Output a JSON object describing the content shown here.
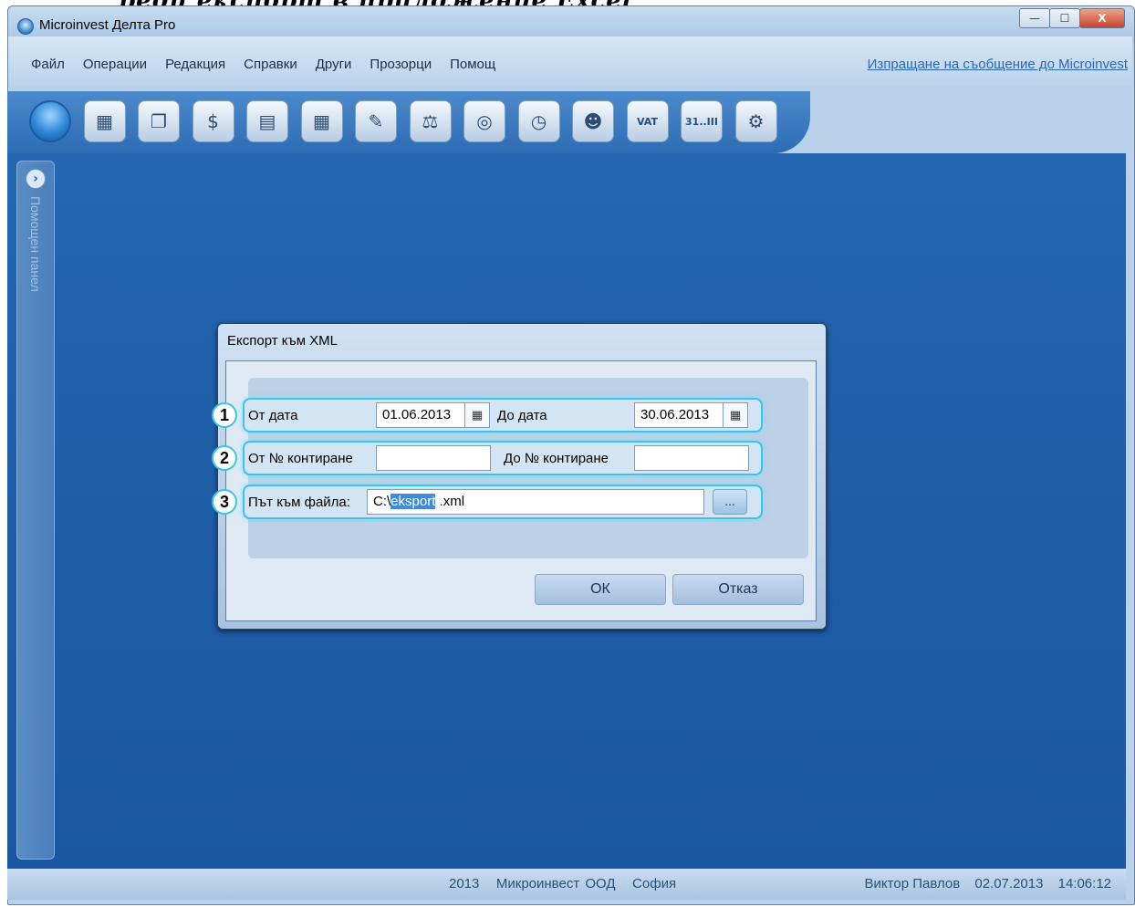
{
  "header_fragment": "реди експорт в приложение Excel",
  "window": {
    "title": "Microinvest Делта Pro",
    "controls": {
      "minimize": "—",
      "maximize": "☐",
      "close": "X"
    }
  },
  "menu": {
    "items": [
      "Файл",
      "Операции",
      "Редакция",
      "Справки",
      "Други",
      "Прозорци",
      "Помощ"
    ],
    "link": "Изпращане на съобщение до Microinvest"
  },
  "toolbar": {
    "icons": [
      "power-icon",
      "documents-icon",
      "copy-icon",
      "money-icon",
      "report-icon",
      "calculator-grid-icon",
      "edit-icon",
      "balance-icon",
      "globe-clock-icon",
      "clock-icon",
      "user-icon",
      "vat-icon",
      "calendar-icon",
      "settings-gear-icon"
    ],
    "vat_label": "VAT",
    "calendar_label": "31..III"
  },
  "side_panel": {
    "label": "Помощен панел"
  },
  "dialog": {
    "title": "Експорт към XML",
    "rows": [
      {
        "badge": "1",
        "from_label": "От дата",
        "from_value": "01.06.2013",
        "to_label": "До дата",
        "to_value": "30.06.2013"
      },
      {
        "badge": "2",
        "from_label": "От № контиране",
        "from_value": "",
        "to_label": "До № контиране",
        "to_value": ""
      },
      {
        "badge": "3",
        "path_label": "Път към файла:",
        "path_prefix": "C:\\",
        "path_selected": "eksport",
        "path_suffix": " .xml",
        "browse_label": "..."
      }
    ],
    "ok_label": "ОК",
    "cancel_label": "Отказ"
  },
  "status": {
    "year": "2013",
    "company": "Микроинвест ООД",
    "city": "София",
    "user": "Виктор Павлов",
    "date": "02.07.2013",
    "time": "14:06:12"
  }
}
